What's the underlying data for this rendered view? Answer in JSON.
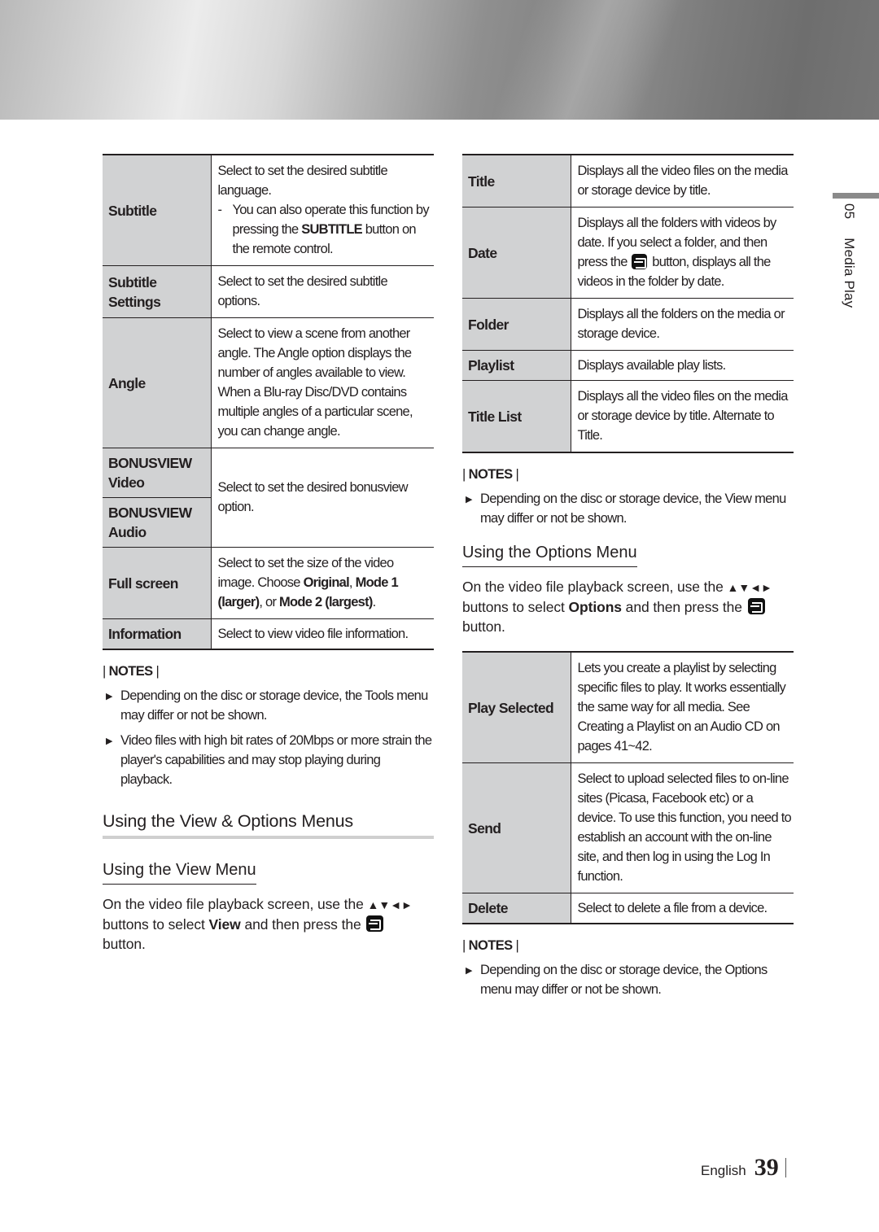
{
  "banner": {
    "description": "metallic-gradient-banner"
  },
  "side_tab": {
    "chapter_number": "05",
    "chapter_title": "Media Play"
  },
  "left": {
    "tools_table": [
      {
        "label": "Subtitle",
        "desc_lines": [
          "Select to set the desired subtitle language."
        ],
        "dash_note": [
          "You can also operate this function by pressing the ",
          "SUBTITLE",
          " button on the remote control."
        ]
      },
      {
        "label_lines": [
          "Subtitle",
          "Settings"
        ],
        "desc": "Select to set the desired subtitle options."
      },
      {
        "label": "Angle",
        "desc": "Select to view a scene from another angle. The Angle option displays the number of angles available to view. When a Blu-ray Disc/DVD contains multiple angles of a particular scene, you can change angle."
      },
      {
        "label_groups": [
          [
            "BONUSVIEW",
            "Video"
          ],
          [
            "BONUSVIEW",
            "Audio"
          ]
        ],
        "desc": "Select to set the desired bonusview option."
      },
      {
        "label": "Full screen",
        "desc_parts": [
          "Select to set the size of the video image. Choose ",
          "Original",
          ", ",
          "Mode 1 (larger)",
          ", or ",
          "Mode 2 (largest)",
          "."
        ]
      },
      {
        "label": "Information",
        "desc": "Select to view video file information."
      }
    ],
    "notes": {
      "heading": "NOTES",
      "items": [
        "Depending on the disc or storage device, the Tools menu may differ or not be shown.",
        "Video files with high bit rates of 20Mbps or more strain the player's capabilities and may stop playing during playback."
      ]
    },
    "section_title": "Using the View & Options Menus",
    "view_menu": {
      "title": "Using the View Menu",
      "body_parts": [
        "On the video file playback screen, use the ",
        "▲▼◄►",
        " buttons to select ",
        "View",
        " and then press the ",
        "button."
      ],
      "enter_icon": "enter-button-icon"
    }
  },
  "right": {
    "view_table": [
      {
        "label": "Title",
        "desc": "Displays all the video files on the media or storage device by title."
      },
      {
        "label": "Date",
        "desc_parts": [
          "Displays all the folders with videos by date. If you select a folder, and then press the ",
          " button, displays all the videos in the folder by date."
        ]
      },
      {
        "label": "Folder",
        "desc": "Displays all the folders on the media or storage device."
      },
      {
        "label": "Playlist",
        "desc": "Displays available play lists."
      },
      {
        "label": "Title List",
        "desc": "Displays all the video files on the media or storage device by title. Alternate to Title."
      }
    ],
    "view_notes": {
      "heading": "NOTES",
      "items": [
        "Depending on the disc or storage device, the View menu may differ or not be shown."
      ]
    },
    "options_menu": {
      "title": "Using the Options Menu",
      "body_parts": [
        "On the video file playback screen, use the ",
        "▲▼◄►",
        " buttons to select ",
        "Options",
        " and then press the ",
        "button."
      ]
    },
    "options_table": [
      {
        "label": "Play Selected",
        "desc": "Lets you create a playlist by selecting specific files to play. It works essentially the same way for all media. See Creating a Playlist on an Audio CD on pages 41~42."
      },
      {
        "label": "Send",
        "desc": "Select to upload selected files to on-line sites (Picasa, Facebook etc) or a device. To use this function, you need to establish an account with the on-line site, and then log in using the Log In function."
      },
      {
        "label": "Delete",
        "desc": "Select to delete a file from a device."
      }
    ],
    "options_notes": {
      "heading": "NOTES",
      "items": [
        "Depending on the disc or storage device, the Options menu may differ or not be shown."
      ]
    }
  },
  "footer": {
    "language": "English",
    "page_number": "39"
  }
}
